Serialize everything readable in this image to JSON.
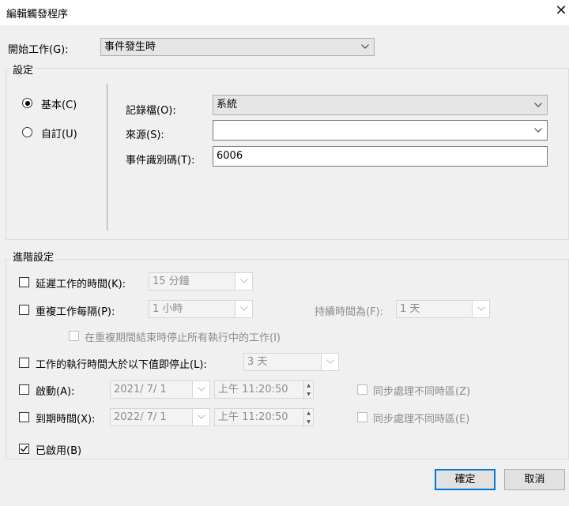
{
  "window": {
    "title": "編輯觸發程序",
    "close_glyph": "✕"
  },
  "start_task": {
    "label": "開始工作(G):",
    "value": "事件發生時"
  },
  "settings": {
    "group_label": "設定",
    "radio_basic": "基本(C)",
    "radio_custom": "自訂(U)",
    "log_label": "記錄檔(O):",
    "log_value": "系統",
    "source_label": "來源(S):",
    "source_value": "",
    "event_id_label": "事件識別碼(T):",
    "event_id_value": "6006"
  },
  "advanced": {
    "group_label": "進階設定",
    "delay_label": "延遲工作的時間(K):",
    "delay_value": "15 分鐘",
    "repeat_label": "重複工作每隔(P):",
    "repeat_value": "1 小時",
    "duration_label": "持續時間為(F):",
    "duration_value": "1 天",
    "stop_at_end_label": "在重複期間結束時停止所有執行中的工作(I)",
    "stop_if_longer_label": "工作的執行時間大於以下值即停止(L):",
    "stop_if_longer_value": "3 天",
    "activate_label": "啟動(A):",
    "activate_date": "2021/  7/  1",
    "activate_time": "上午 11:20:50",
    "activate_sync_label": "同步處理不同時區(Z)",
    "expire_label": "到期時間(X):",
    "expire_date": "2022/  7/  1",
    "expire_time": "上午 11:20:50",
    "expire_sync_label": "同步處理不同時區(E)",
    "enabled_label": "已啟用(B)"
  },
  "buttons": {
    "ok": "確定",
    "cancel": "取消"
  },
  "colors": {
    "accent": "#0078d7",
    "dialog_bg": "#f0f0f0"
  }
}
